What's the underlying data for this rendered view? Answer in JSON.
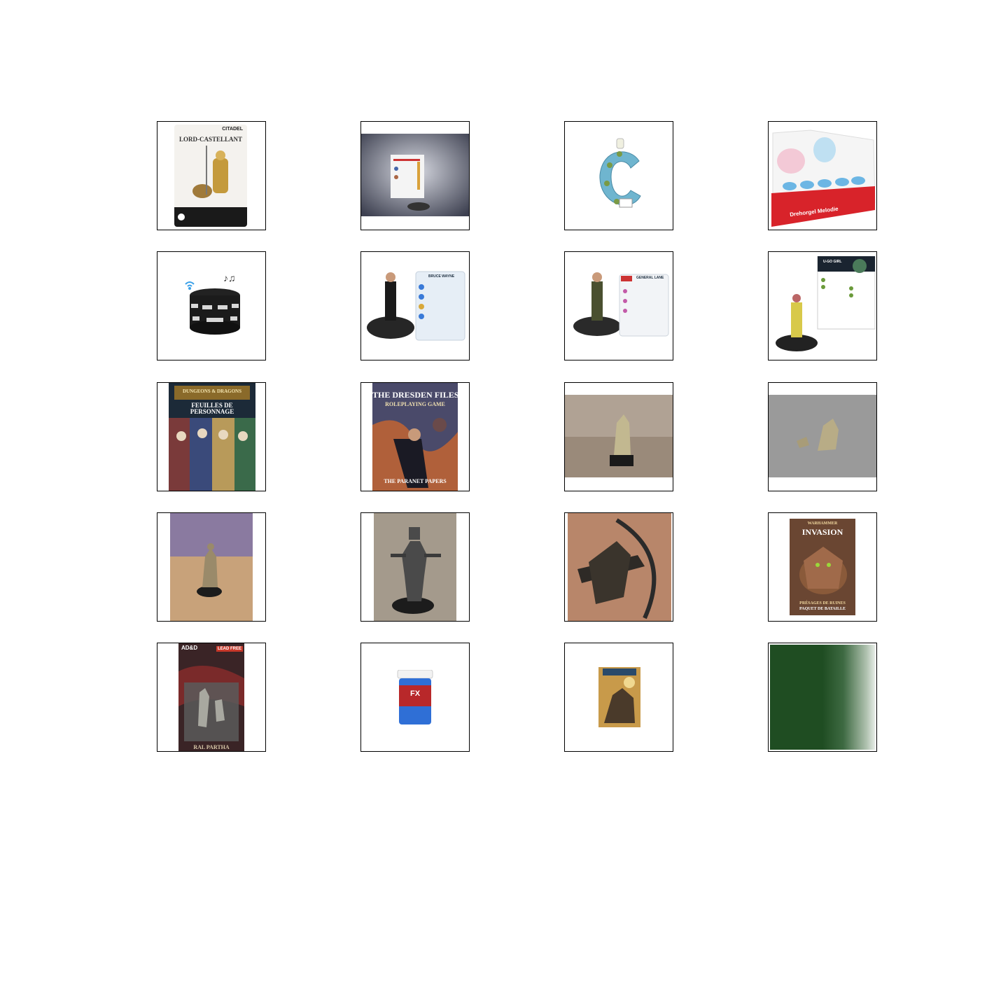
{
  "products": [
    {
      "brand": "CITADEL",
      "title": "LORD-CASTELLANT"
    },
    {
      "title": ""
    },
    {
      "title": ""
    },
    {
      "title": "Drehorgel Melodie"
    },
    {
      "title": ""
    },
    {
      "title": "BRUCE WAYNE"
    },
    {
      "title": "GENERAL LANE"
    },
    {
      "title": "U-GO GIRL"
    },
    {
      "brand": "DUNGEONS & DRAGONS",
      "title": "FEUILLES DE PERSONNAGE"
    },
    {
      "brand": "THE DRESDEN FILES",
      "subtitle": "ROLEPLAYING GAME",
      "title": "THE PARANET PAPERS"
    },
    {
      "title": ""
    },
    {
      "title": ""
    },
    {
      "title": ""
    },
    {
      "title": ""
    },
    {
      "title": ""
    },
    {
      "brand": "WARHAMMER",
      "title": "INVASION",
      "subtitle": "PRÉSAGES DE RUINES",
      "subtitle2": "PAQUET DE BATAILLE"
    },
    {
      "brand": "AD&D",
      "badge": "LEAD FREE",
      "title": "RAL PARTHA"
    },
    {
      "title": "FX"
    },
    {
      "title": ""
    },
    {
      "title": ""
    }
  ],
  "colors": {
    "frame": "#000000",
    "background": "#ffffff",
    "swatch_green": "#1f4d22"
  }
}
